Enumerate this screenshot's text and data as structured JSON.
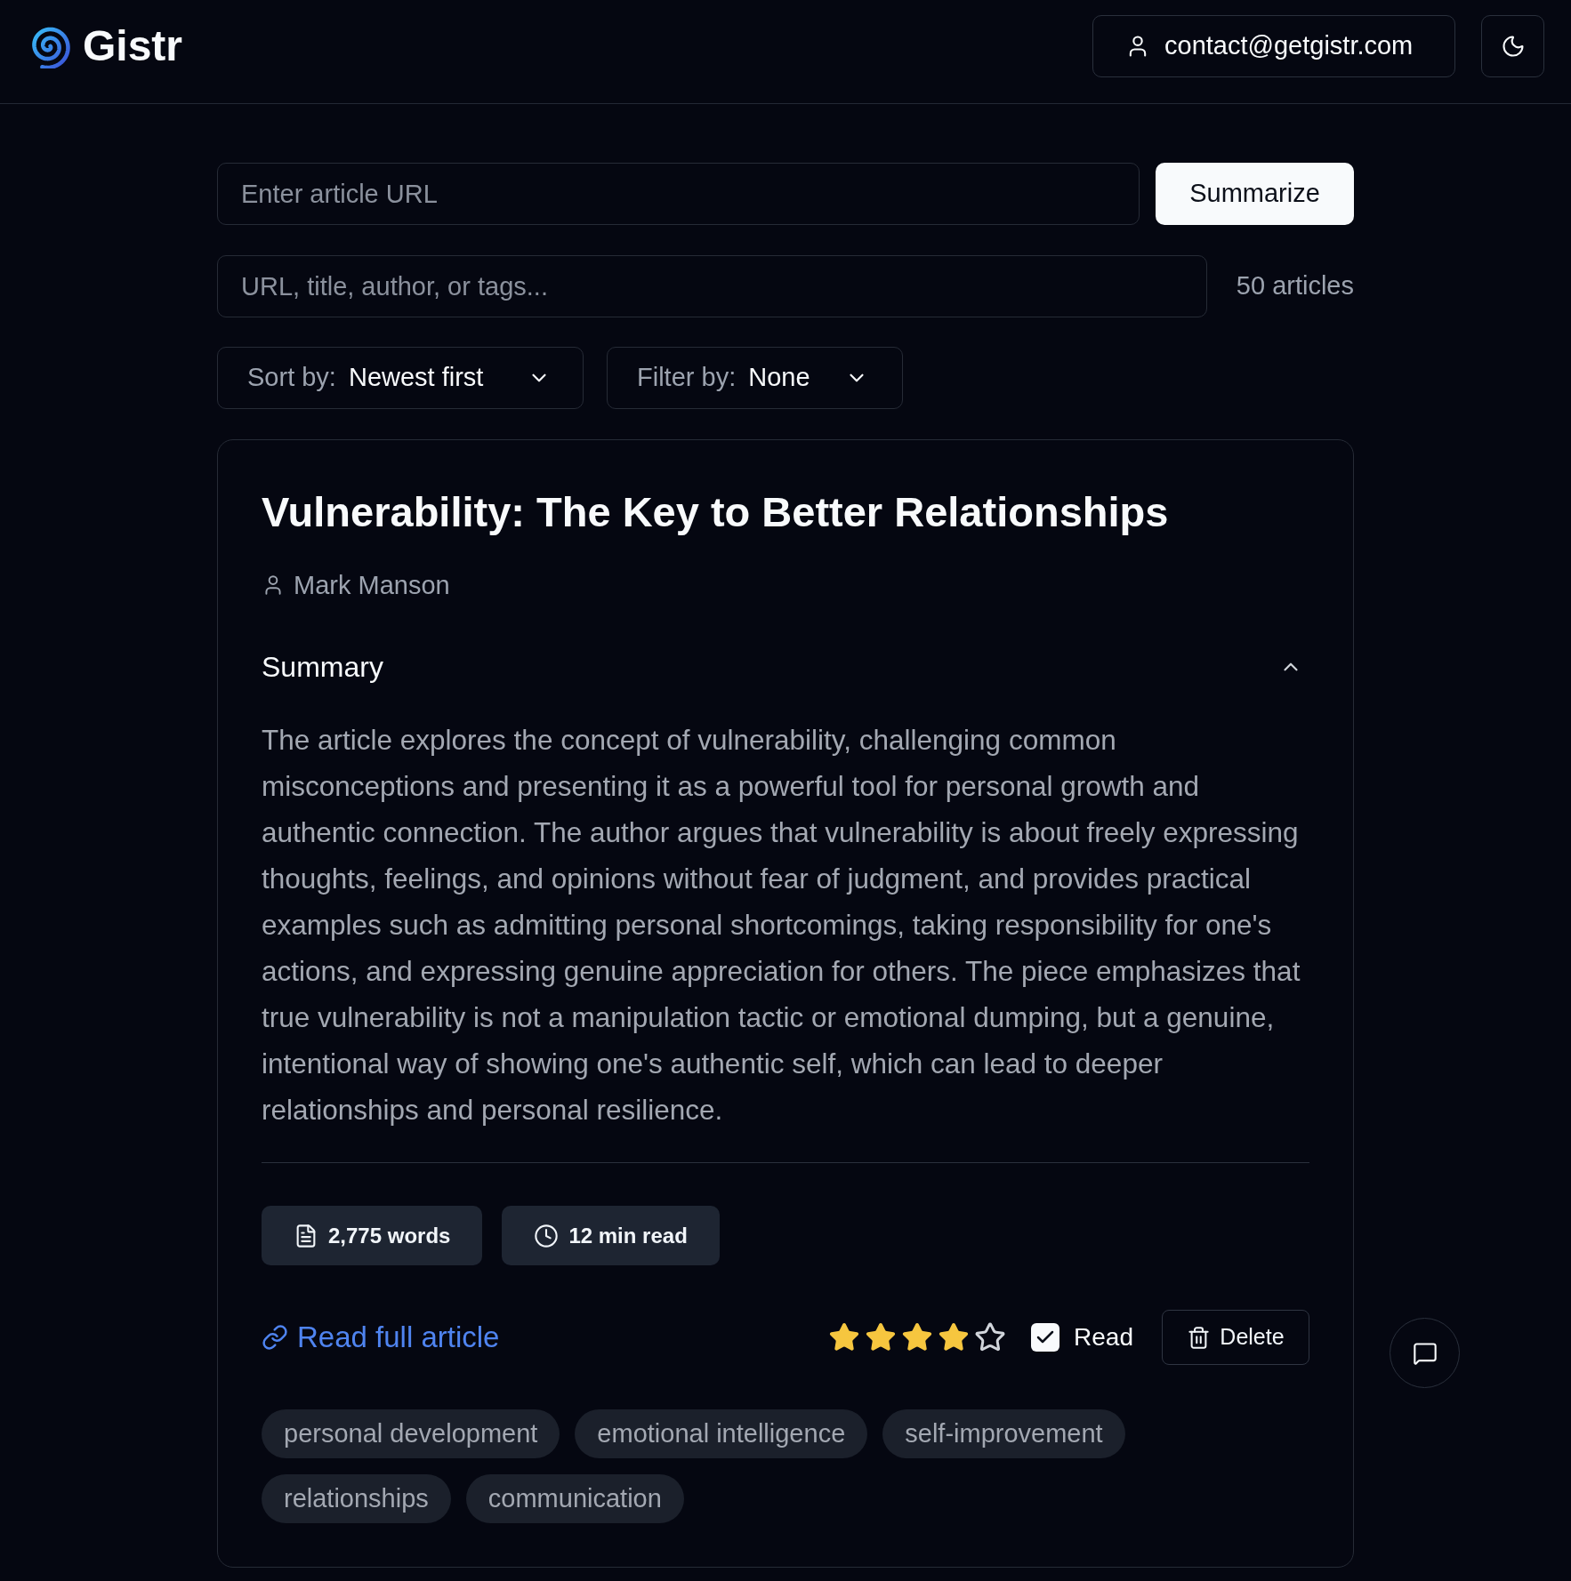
{
  "header": {
    "logo": "Gistr",
    "account_button": "contact@getgistr.com"
  },
  "url_form": {
    "placeholder": "Enter article URL",
    "submit_button": "Summarize"
  },
  "search": {
    "placeholder": "URL, title, author, or tags...",
    "count": "50 articles"
  },
  "sort": {
    "label": "Sort by:",
    "value": "Newest first"
  },
  "filter": {
    "label": "Filter by:",
    "value": "None"
  },
  "articles": [
    {
      "title": "Vulnerability: The Key to Better Relationships",
      "author": "Mark Manson",
      "summary": {
        "heading": "Summary",
        "expanded": true,
        "text": "The article explores the concept of vulnerability, challenging common misconceptions and presenting it as a powerful tool for personal growth and authentic connection. The author argues that vulnerability is about freely expressing thoughts, feelings, and opinions without fear of judgment, and provides practical examples such as admitting personal shortcomings, taking responsibility for one's actions, and expressing genuine appreciation for others. The piece emphasizes that true vulnerability is not a manipulation tactic or emotional dumping, but a genuine, intentional way of showing one's authentic self, which can lead to deeper relationships and personal resilience."
      },
      "stats": [
        {
          "kind": "words",
          "label": "2,775 words"
        },
        {
          "kind": "time",
          "label": "12 min read"
        }
      ],
      "link": "Read full article",
      "stars": 4,
      "read": {
        "label": "Read",
        "checked": true
      },
      "delete_button": "Delete",
      "tags": [
        "personal development",
        "emotional intelligence",
        "self-improvement",
        "relationships",
        "communication"
      ]
    }
  ]
}
